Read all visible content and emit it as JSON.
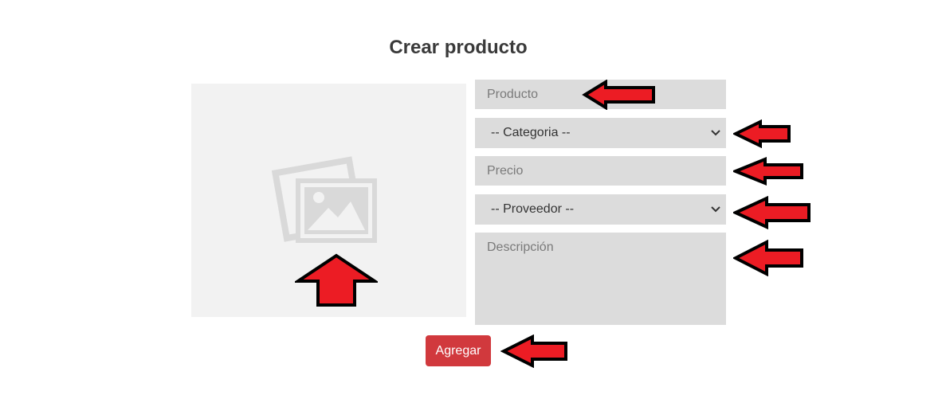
{
  "form": {
    "title": "Crear producto",
    "product_placeholder": "Producto",
    "category_select": {
      "selected": "-- Categoria --"
    },
    "price_placeholder": "Precio",
    "supplier_select": {
      "selected": "-- Proveedor --"
    },
    "description_placeholder": "Descripción",
    "submit_label": "Agregar"
  },
  "image_placeholder": {
    "icon": "image-placeholder-icon"
  },
  "annotations": {
    "arrow_color": "#ec1c24",
    "outline_color": "#000000"
  },
  "colors": {
    "field_background": "#dcdcdc",
    "image_panel_background": "#f2f2f2",
    "button_background": "#d1393d"
  }
}
